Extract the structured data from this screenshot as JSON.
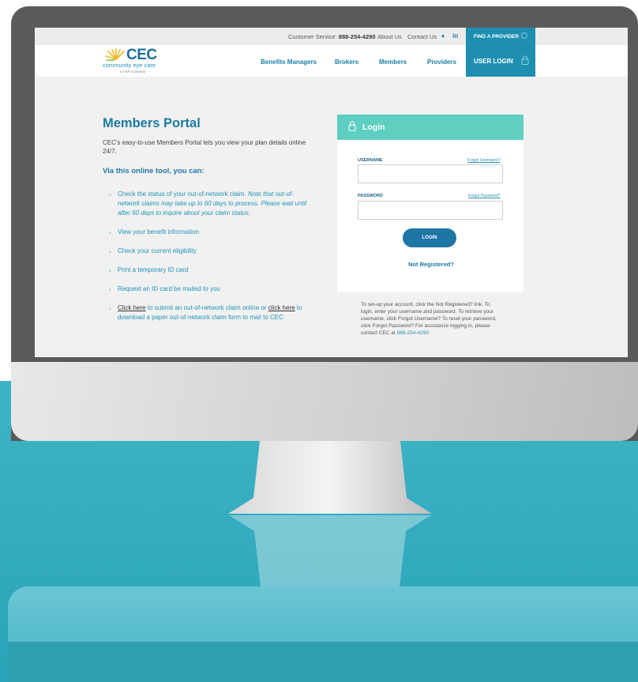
{
  "topbar": {
    "customer_service_label": "Customer Service:",
    "customer_service_phone": "888-254-4290",
    "about": "About Us",
    "contact": "Contact Us",
    "twitter_glyph": "𝕪",
    "linkedin_glyph": "in",
    "find_provider": "FIND A PROVIDER"
  },
  "logo": {
    "name": "CEC",
    "subtitle": "community eye care",
    "tagline": "a VSP company"
  },
  "nav": {
    "items": [
      "Benefits Managers",
      "Brokers",
      "Members",
      "Providers"
    ],
    "user_login": "USER LOGIN"
  },
  "main": {
    "title": "Members Portal",
    "description": "CEC's easy-to-use Members Portal lets you view your plan details online 24/7.",
    "subtitle": "Via this online tool, you can:",
    "bullet1_a": "Check the status of your out-of-network claim. ",
    "bullet1_b": "Note that out-of-network claims may take up to 60 days to process. Please wait until after 60 days to inquire about your claim status.",
    "bullet2": "View your benefit information",
    "bullet3": "Check your current eligibility",
    "bullet4": "Print a temporary ID card",
    "bullet5": "Request an ID card be mailed to you",
    "bullet6_link1": "Click here",
    "bullet6_mid": " to submit an out-of-network claim online or ",
    "bullet6_link2": "click here",
    "bullet6_end": " to download a paper out-of-network claim form to mail to CEC"
  },
  "login": {
    "title": "Login",
    "username_label": "USERNAME",
    "forgot_username": "Forgot Username?",
    "username_value": "",
    "password_label": "PASSWORD",
    "forgot_password": "Forgot Password?",
    "password_value": "",
    "button": "LOGIN",
    "not_registered": "Not Registered?"
  },
  "help": {
    "text": "To set-up your account, click the Not Registered? link. To login, enter your username and password. To retrieve your username, click Forgot Username? To reset your password, click Forgot Password? For assistance logging in, please contact CEC at ",
    "phone": "888-254-4290",
    "end": "."
  },
  "colors": {
    "brand_blue": "#1d7aa2",
    "login_header": "#5ecfc0",
    "nav_active": "#1e8fb0",
    "background_teal": "#3fb3c6"
  }
}
